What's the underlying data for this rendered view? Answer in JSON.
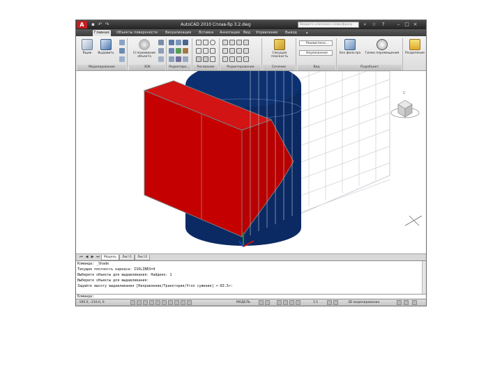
{
  "app": {
    "logo_letter": "A",
    "title": "AutoCAD 2010   Сплав-бр 3.2.dwg"
  },
  "search": {
    "placeholder": "Введите ключевое слово/фразу"
  },
  "tabs": [
    "Главная",
    "Объекты поверхности",
    "Визуализация",
    "Вставка",
    "Аннотации",
    "Вид",
    "Управление",
    "Вывод"
  ],
  "ribbon": {
    "modeling": {
      "box_label": "Ящик",
      "extrude_label": "Выдавить",
      "panel": "Моделирование"
    },
    "mesh": {
      "smooth_label": "Сглаживание объекта",
      "panel": "3DK"
    },
    "solid_edit": {
      "panel": "Редактиро..."
    },
    "draw": {
      "panel": "Рисование"
    },
    "modify": {
      "panel": "Редактирование"
    },
    "section": {
      "section_label": "Секущая плоскость",
      "panel": "Сечение"
    },
    "view": {
      "combo1": "Реалистичн...",
      "combo2": "Неуказанное",
      "panel": "Вид"
    },
    "subobject": {
      "no_filter_label": "Без фильтра",
      "move_label": "Гизмо перемещения",
      "panel": "Подобъект"
    },
    "layers": {
      "label": "Разделение"
    }
  },
  "viewcube": {
    "compass_n": "С"
  },
  "layout_tabs": [
    "Модель",
    "Лист1",
    "Лист2"
  ],
  "command_lines": [
    "Команда: _Shade",
    "Текущая плотность каркаса: ISOLINES=4",
    "Выберите объекты для выдавливания: Найдено: 1",
    "Выберите объекты для выдавливания:",
    "Задайте высоту выдавливания [Направление/Траектория/Угол сужения] <-83.5>:"
  ],
  "command_prompt": "Команда:",
  "status": {
    "coords": "-190.0, -210.0, 0",
    "model_label": "МОДЕЛЬ",
    "scale": "1:1",
    "workspace": "3D моделирование"
  },
  "colors": {
    "solid_red": "#c40000",
    "solid_navy": "#0b2a63",
    "grid": "#cfcfd6",
    "ribbon_active": "#e6e6e6"
  }
}
